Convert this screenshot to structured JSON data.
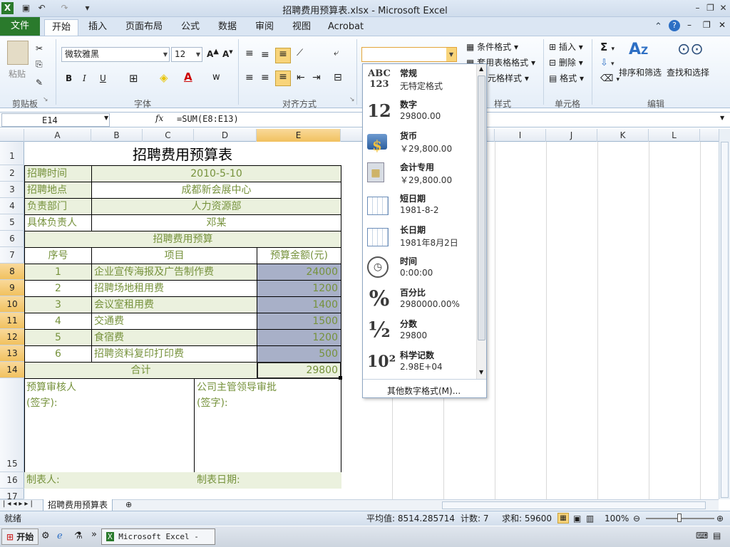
{
  "window": {
    "title": "招聘费用预算表.xlsx - Microsoft Excel"
  },
  "ribbon": {
    "tabs": [
      "文件",
      "开始",
      "插入",
      "页面布局",
      "公式",
      "数据",
      "审阅",
      "视图",
      "Acrobat"
    ],
    "clipboard": {
      "paste": "粘贴",
      "group": "剪贴板"
    },
    "font": {
      "name": "微软雅黑",
      "size": "12",
      "bold": "B",
      "italic": "I",
      "underline": "U",
      "group": "字体"
    },
    "alignment": {
      "group": "对齐方式"
    },
    "styles": {
      "conditional": "条件格式",
      "table": "套用表格格式",
      "cell": "元格样式",
      "group": "样式"
    },
    "cells": {
      "insert": "插入",
      "delete": "删除",
      "format": "格式",
      "group": "单元格"
    },
    "editing": {
      "sum": "Σ",
      "sort": "排序和筛选",
      "find": "查找和选择",
      "group": "编辑"
    }
  },
  "formula_bar": {
    "name_box": "E14",
    "fx": "fx",
    "formula": "=SUM(E8:E13)"
  },
  "columns": [
    "A",
    "B",
    "C",
    "D",
    "E",
    "F",
    "G",
    "H",
    "I",
    "J",
    "K",
    "L"
  ],
  "rows": [
    "1",
    "2",
    "3",
    "4",
    "5",
    "6",
    "7",
    "8",
    "9",
    "10",
    "11",
    "12",
    "13",
    "14",
    "15",
    "16",
    "17"
  ],
  "sheet": {
    "title": "招聘费用预算表",
    "r2": {
      "label": "招聘时间",
      "value": "2010-5-10"
    },
    "r3": {
      "label": "招聘地点",
      "value": "成都新会展中心"
    },
    "r4": {
      "label": "负责部门",
      "value": "人力资源部"
    },
    "r5": {
      "label": "具体负责人",
      "value": "邓某"
    },
    "r6": "招聘费用预算",
    "headers": {
      "no": "序号",
      "item": "项目",
      "amount": "预算金额(元)"
    },
    "items": [
      {
        "no": "1",
        "item": "企业宣传海报及广告制作费",
        "amount": "24000"
      },
      {
        "no": "2",
        "item": "招聘场地租用费",
        "amount": "1200"
      },
      {
        "no": "3",
        "item": "会议室租用费",
        "amount": "1400"
      },
      {
        "no": "4",
        "item": "交通费",
        "amount": "1500"
      },
      {
        "no": "5",
        "item": "食宿费",
        "amount": "1200"
      },
      {
        "no": "6",
        "item": "招聘资料复印打印费",
        "amount": "500"
      }
    ],
    "total": {
      "label": "合计",
      "value": "29800"
    },
    "review": {
      "left": "预算审核人",
      "right": "公司主管领导审批",
      "sign": "(签字):"
    },
    "footer": {
      "maker": "制表人:",
      "date": "制表日期:"
    }
  },
  "number_format_popup": {
    "items": [
      {
        "icon": "ABC 123",
        "name": "常规",
        "example": "无特定格式"
      },
      {
        "icon": "12",
        "name": "数字",
        "example": "29800.00"
      },
      {
        "icon": "currency-icon",
        "name": "货币",
        "example": "￥29,800.00"
      },
      {
        "icon": "accounting-icon",
        "name": "会计专用",
        "example": "￥29,800.00"
      },
      {
        "icon": "calendar-icon",
        "name": "短日期",
        "example": "1981-8-2"
      },
      {
        "icon": "calendar-icon",
        "name": "长日期",
        "example": "1981年8月2日"
      },
      {
        "icon": "clock-icon",
        "name": "时间",
        "example": "0:00:00"
      },
      {
        "icon": "%",
        "name": "百分比",
        "example": "2980000.00%"
      },
      {
        "icon": "½",
        "name": "分数",
        "example": "29800"
      },
      {
        "icon": "10²",
        "name": "科学记数",
        "example": "2.98E+04"
      }
    ],
    "more": "其他数字格式(M)..."
  },
  "sheet_tab": "招聘费用预算表",
  "status": {
    "ready": "就绪",
    "average": "平均值: 8514.285714",
    "count": "计数: 7",
    "sum": "求和: 59600",
    "zoom": "100%"
  },
  "taskbar": {
    "start": "开始",
    "app": "Microsoft Excel - ..."
  }
}
